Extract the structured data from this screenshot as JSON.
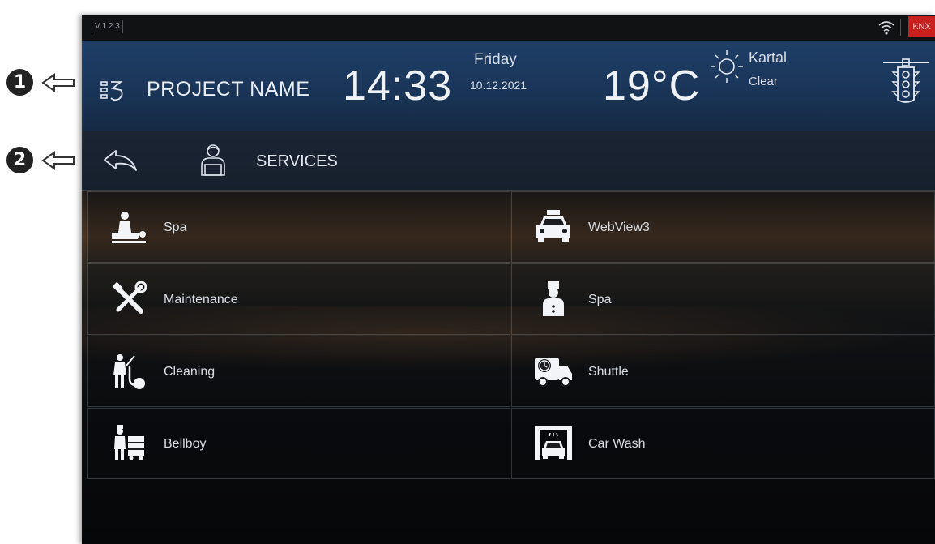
{
  "callouts": [
    {
      "number": "1"
    },
    {
      "number": "2"
    }
  ],
  "status_bar": {
    "version": "V.1.2.3",
    "knx_label": "KNX"
  },
  "header": {
    "project_name": "PROJECT NAME",
    "time": "14:33",
    "day": "Friday",
    "date": "10.12.2021",
    "temperature": "19°C",
    "city": "Kartal",
    "condition": "Clear"
  },
  "subheader": {
    "title": "SERVICES"
  },
  "services": [
    {
      "label": "Spa",
      "icon": "massage-icon"
    },
    {
      "label": "WebView3",
      "icon": "taxi-icon"
    },
    {
      "label": "Maintenance",
      "icon": "tools-icon"
    },
    {
      "label": "Spa",
      "icon": "bellman-icon"
    },
    {
      "label": "Cleaning",
      "icon": "cleaning-icon"
    },
    {
      "label": "Shuttle",
      "icon": "shuttle-icon"
    },
    {
      "label": "Bellboy",
      "icon": "bellboy-icon"
    },
    {
      "label": "Car Wash",
      "icon": "car-wash-icon"
    }
  ],
  "colors": {
    "header_bg": "#1f3f68",
    "knx_red": "#c8201f"
  }
}
